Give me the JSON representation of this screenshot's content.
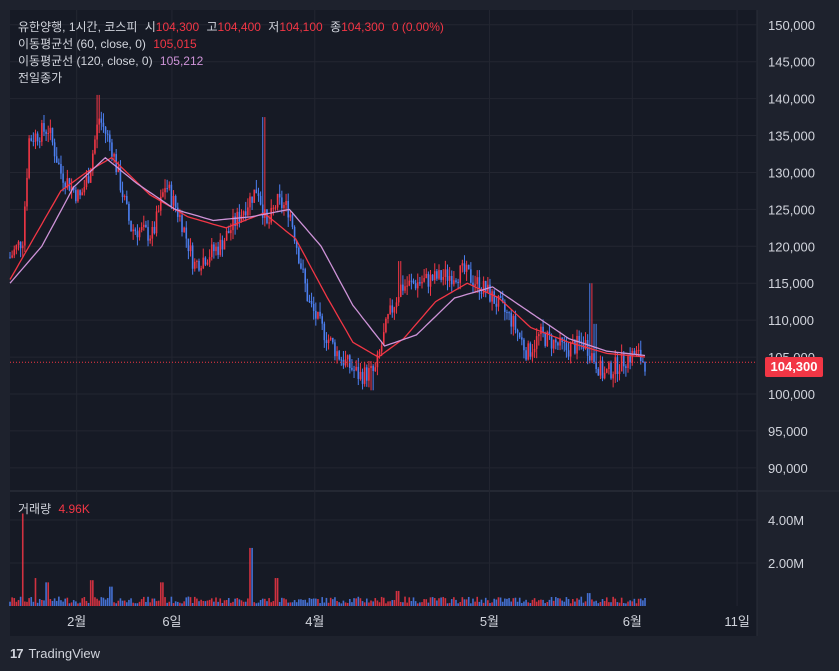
{
  "header": {
    "symbol": "유한양행, 1시간, 코스피",
    "open_label": "시",
    "open": "104,300",
    "high_label": "고",
    "high": "104,400",
    "low_label": "저",
    "low": "104,100",
    "close_label": "종",
    "close": "104,300",
    "change": "0 (0.00%)"
  },
  "indicators": [
    {
      "label": "이동평균선 (60, close, 0)",
      "value": "105,015",
      "color": "#f23645"
    },
    {
      "label": "이동평균선 (120, close, 0)",
      "value": "105,212",
      "color": "#ce93d8"
    },
    {
      "label": "전일종가"
    }
  ],
  "volume": {
    "label": "거래량",
    "value": "4.96K"
  },
  "last_price_tag": "104,300",
  "footer": {
    "brand": "TradingView",
    "logo": "17"
  },
  "colors": {
    "background": "#1e222d",
    "up": "#f23645",
    "down": "#4c7ff0",
    "ma60": "#f23645",
    "ma120": "#ce93d8"
  },
  "chart_data": {
    "type": "candlestick",
    "title": "유한양행, 1시간, 코스피",
    "price_axis_ticks": [
      "150,000",
      "145,000",
      "140,000",
      "135,000",
      "130,000",
      "125,000",
      "120,000",
      "115,000",
      "110,000",
      "105,000",
      "100,000",
      "95,000",
      "90,000"
    ],
    "volume_axis_ticks": [
      "4.00M",
      "2.00M"
    ],
    "x_axis_ticks": [
      "2월",
      "6일",
      "4월",
      "5월",
      "6월",
      "11일"
    ],
    "ylim": [
      87000,
      152000
    ],
    "volume_ylim": [
      0,
      5300000
    ],
    "last_price": 104300,
    "price_path_keypoints": [
      {
        "t": 0.0,
        "price": 118500
      },
      {
        "t": 0.02,
        "price": 121000
      },
      {
        "t": 0.03,
        "price": 134500
      },
      {
        "t": 0.06,
        "price": 136000
      },
      {
        "t": 0.08,
        "price": 130000
      },
      {
        "t": 0.11,
        "price": 126500
      },
      {
        "t": 0.125,
        "price": 130000
      },
      {
        "t": 0.14,
        "price": 137500
      },
      {
        "t": 0.16,
        "price": 133500
      },
      {
        "t": 0.19,
        "price": 122500
      },
      {
        "t": 0.225,
        "price": 121500
      },
      {
        "t": 0.245,
        "price": 128500
      },
      {
        "t": 0.27,
        "price": 123500
      },
      {
        "t": 0.29,
        "price": 117500
      },
      {
        "t": 0.33,
        "price": 120000
      },
      {
        "t": 0.36,
        "price": 124000
      },
      {
        "t": 0.39,
        "price": 128000
      },
      {
        "t": 0.405,
        "price": 122500
      },
      {
        "t": 0.42,
        "price": 126000
      },
      {
        "t": 0.44,
        "price": 125000
      },
      {
        "t": 0.47,
        "price": 112500
      },
      {
        "t": 0.49,
        "price": 109000
      },
      {
        "t": 0.52,
        "price": 105000
      },
      {
        "t": 0.55,
        "price": 102500
      },
      {
        "t": 0.575,
        "price": 103000
      },
      {
        "t": 0.595,
        "price": 110000
      },
      {
        "t": 0.615,
        "price": 114500
      },
      {
        "t": 0.66,
        "price": 115500
      },
      {
        "t": 0.715,
        "price": 116500
      },
      {
        "t": 0.75,
        "price": 114000
      },
      {
        "t": 0.79,
        "price": 110000
      },
      {
        "t": 0.815,
        "price": 105500
      },
      {
        "t": 0.835,
        "price": 108000
      },
      {
        "t": 0.875,
        "price": 106000
      },
      {
        "t": 0.905,
        "price": 107000
      },
      {
        "t": 0.935,
        "price": 102500
      },
      {
        "t": 0.965,
        "price": 104500
      },
      {
        "t": 0.985,
        "price": 105500
      },
      {
        "t": 1.0,
        "price": 104300
      }
    ],
    "spikes": [
      {
        "t": 0.14,
        "high": 140500
      },
      {
        "t": 0.4,
        "high": 137500
      },
      {
        "t": 0.615,
        "high": 118000
      },
      {
        "t": 0.915,
        "high": 115000
      },
      {
        "t": 0.57,
        "low": 100500
      },
      {
        "t": 0.92,
        "high": 109500
      }
    ],
    "ma60_keypoints": [
      {
        "t": 0.0,
        "price": 115500
      },
      {
        "t": 0.03,
        "price": 120000
      },
      {
        "t": 0.08,
        "price": 127500
      },
      {
        "t": 0.12,
        "price": 130000
      },
      {
        "t": 0.16,
        "price": 132000
      },
      {
        "t": 0.22,
        "price": 127000
      },
      {
        "t": 0.28,
        "price": 124000
      },
      {
        "t": 0.34,
        "price": 122500
      },
      {
        "t": 0.4,
        "price": 124500
      },
      {
        "t": 0.45,
        "price": 121000
      },
      {
        "t": 0.5,
        "price": 113000
      },
      {
        "t": 0.54,
        "price": 107000
      },
      {
        "t": 0.58,
        "price": 105000
      },
      {
        "t": 0.62,
        "price": 107500
      },
      {
        "t": 0.67,
        "price": 112500
      },
      {
        "t": 0.72,
        "price": 115000
      },
      {
        "t": 0.77,
        "price": 113000
      },
      {
        "t": 0.82,
        "price": 109000
      },
      {
        "t": 0.88,
        "price": 107000
      },
      {
        "t": 0.94,
        "price": 105500
      },
      {
        "t": 1.0,
        "price": 105015
      }
    ],
    "ma120_keypoints": [
      {
        "t": 0.0,
        "price": 115000
      },
      {
        "t": 0.05,
        "price": 120000
      },
      {
        "t": 0.1,
        "price": 128000
      },
      {
        "t": 0.15,
        "price": 132000
      },
      {
        "t": 0.2,
        "price": 128500
      },
      {
        "t": 0.26,
        "price": 125000
      },
      {
        "t": 0.32,
        "price": 123500
      },
      {
        "t": 0.38,
        "price": 124000
      },
      {
        "t": 0.44,
        "price": 125000
      },
      {
        "t": 0.49,
        "price": 120000
      },
      {
        "t": 0.54,
        "price": 112000
      },
      {
        "t": 0.59,
        "price": 106500
      },
      {
        "t": 0.64,
        "price": 108000
      },
      {
        "t": 0.7,
        "price": 113000
      },
      {
        "t": 0.76,
        "price": 114500
      },
      {
        "t": 0.82,
        "price": 111000
      },
      {
        "t": 0.88,
        "price": 107500
      },
      {
        "t": 0.94,
        "price": 105800
      },
      {
        "t": 1.0,
        "price": 105212
      }
    ],
    "volume_spikes": [
      {
        "t": 0.02,
        "volume": 4300000
      },
      {
        "t": 0.04,
        "volume": 1300000
      },
      {
        "t": 0.06,
        "volume": 1100000
      },
      {
        "t": 0.13,
        "volume": 1200000
      },
      {
        "t": 0.16,
        "volume": 900000
      },
      {
        "t": 0.24,
        "volume": 1100000
      },
      {
        "t": 0.38,
        "volume": 2700000
      },
      {
        "t": 0.42,
        "volume": 1300000
      },
      {
        "t": 0.61,
        "volume": 700000
      },
      {
        "t": 0.91,
        "volume": 600000
      }
    ]
  }
}
